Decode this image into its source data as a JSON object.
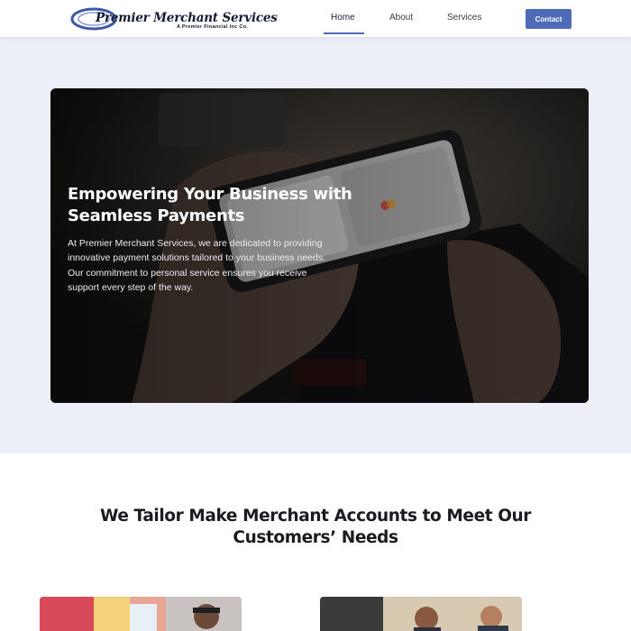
{
  "header": {
    "logo_name": "Premier Merchant Services",
    "logo_subtitle": "A Premier Financial Inc Co.",
    "nav": {
      "home": "Home",
      "about": "About",
      "services": "Services"
    },
    "contact_label": "Contact"
  },
  "hero": {
    "title": "Empowering Your Business with Seamless Payments",
    "text": "At Premier Merchant Services, we are dedicated to providing innovative payment solutions tailored to your business needs. Our commitment to personal service ensures you receive support every step of the way."
  },
  "tailor": {
    "heading": "We Tailor Make Merchant Accounts to Meet Our Customers’ Needs"
  },
  "colors": {
    "accent": "#4f6ab8",
    "hero_section_bg": "#eceef8",
    "logo_text": "#141a33"
  }
}
